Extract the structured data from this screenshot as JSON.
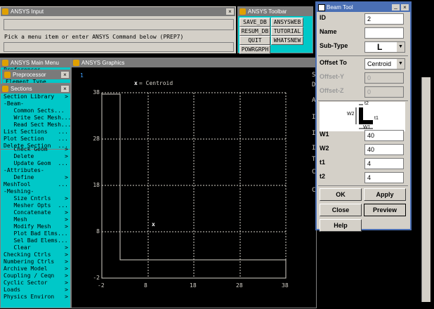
{
  "input_window": {
    "title": "ANSYS Input",
    "prompt": "Pick a menu item or enter ANSYS Command below (PREP7)"
  },
  "toolbar_window": {
    "title": "ANSYS Toolbar",
    "buttons": [
      "SAVE_DB",
      "ANSYSWEB",
      "RESUM_DB",
      "TUTORIAL",
      "QUIT",
      "WHATSNEW",
      "POWRGRPH"
    ]
  },
  "main_menu": {
    "title": "ANSYS Main Menu",
    "partial_item": "Preferences"
  },
  "preprocessor": {
    "title": "Preprocessor",
    "partial_item": "Element Type"
  },
  "sections": {
    "title": "Sections",
    "items": [
      {
        "label": "Section Library",
        "arrow": ">"
      },
      {
        "label": "-Beam-",
        "arrow": ""
      },
      {
        "label": "   Common Sects...",
        "arrow": ""
      },
      {
        "label": "   Write Sec Mesh...",
        "arrow": ""
      },
      {
        "label": "   Read Sect Mesh...",
        "arrow": ""
      },
      {
        "label": "List Sections",
        "arrow": "..."
      },
      {
        "label": "Plot Section",
        "arrow": "..."
      },
      {
        "label": "Delete Section",
        "arrow": "..."
      }
    ]
  },
  "main_menu_items": [
    {
      "label": "   Check Geom",
      "arrow": ">"
    },
    {
      "label": "   Delete",
      "arrow": ">"
    },
    {
      "label": "   Update Geom",
      "arrow": "..."
    },
    {
      "label": "-Attributes-",
      "arrow": ""
    },
    {
      "label": "   Define",
      "arrow": ">"
    },
    {
      "label": "MeshTool",
      "arrow": "..."
    },
    {
      "label": "-Meshing-",
      "arrow": ""
    },
    {
      "label": "   Size Cntrls",
      "arrow": ">"
    },
    {
      "label": "   Mesher Opts",
      "arrow": "..."
    },
    {
      "label": "   Concatenate",
      "arrow": ">"
    },
    {
      "label": "   Mesh",
      "arrow": ">"
    },
    {
      "label": "   Modify Mesh",
      "arrow": ">"
    },
    {
      "label": "   Plot Bad Elms...",
      "arrow": ""
    },
    {
      "label": "   Sel Bad Elems...",
      "arrow": ""
    },
    {
      "label": "   Clear",
      "arrow": ">"
    },
    {
      "label": "Checking Ctrls",
      "arrow": ">"
    },
    {
      "label": "Numbering Ctrls",
      "arrow": ">"
    },
    {
      "label": "Archive Model",
      "arrow": ">"
    },
    {
      "label": "Coupling / Ceqn",
      "arrow": ">"
    },
    {
      "label": "Cyclic Sector",
      "arrow": ">"
    },
    {
      "label": "Loads",
      "arrow": ">"
    },
    {
      "label": "Physics Environ",
      "arrow": ">"
    }
  ],
  "graphics": {
    "title": "ANSYS Graphics",
    "window_number": "1",
    "legend": "= Centroid",
    "centroid_marker": "x",
    "y_ticks": [
      "38",
      "28",
      "18",
      "8",
      "-2"
    ],
    "x_ticks": [
      "-2",
      "8",
      "18",
      "28",
      "38"
    ],
    "right_letters": [
      "S",
      "D",
      "A",
      "I",
      "I",
      "I",
      "T",
      "C",
      "C"
    ]
  },
  "beam_tool": {
    "title": "Beam Tool",
    "fields": {
      "id_label": "ID",
      "id_value": "2",
      "name_label": "Name",
      "name_value": "",
      "subtype_label": "Sub-Type",
      "subtype_value": "L",
      "offset_label": "Offset To",
      "offset_value": "Centroid",
      "offsety_label": "Offset-Y",
      "offsety_value": "0",
      "offsetz_label": "Offset-Z",
      "offsetz_value": "0",
      "w1_label": "W1",
      "w1_value": "40",
      "w2_label": "W2",
      "w2_value": "40",
      "t1_label": "t1",
      "t1_value": "4",
      "t2_label": "t2",
      "t2_value": "4"
    },
    "diagram_labels": {
      "w2": "W2",
      "t1": "t1",
      "t2": "t2",
      "w1": "W1"
    },
    "buttons": {
      "ok": "OK",
      "apply": "Apply",
      "close": "Close",
      "preview": "Preview",
      "help": "Help"
    }
  }
}
